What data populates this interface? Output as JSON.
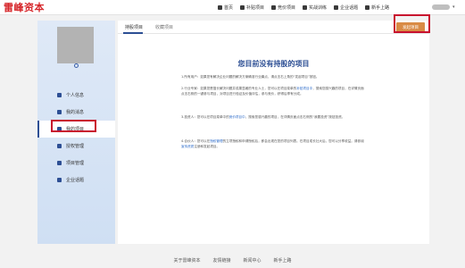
{
  "header": {
    "logo": "雷峰资本",
    "nav": [
      {
        "label": "首页",
        "icon": "home-icon"
      },
      {
        "label": "补贴项目",
        "icon": "grid-icon"
      },
      {
        "label": "竞价项目",
        "icon": "gavel-icon"
      },
      {
        "label": "实战训练",
        "icon": "target-icon"
      },
      {
        "label": "企业话题",
        "icon": "chat-icon"
      },
      {
        "label": "新手上路",
        "icon": "compass-icon"
      }
    ]
  },
  "sidebar": {
    "items": [
      {
        "label": "个人信息",
        "icon": "user-icon"
      },
      {
        "label": "我的消息",
        "icon": "message-icon"
      },
      {
        "label": "我的项目",
        "icon": "project-icon",
        "active": true
      },
      {
        "label": "授权管理",
        "icon": "key-icon"
      },
      {
        "label": "项目管理",
        "icon": "list-icon"
      },
      {
        "label": "企业话题",
        "icon": "topic-icon"
      }
    ]
  },
  "main": {
    "tabs": [
      "持股项目",
      "收藏项目"
    ],
    "launch_button": "发起项目",
    "empty_title": "您目前没有持股的项目",
    "paragraphs": [
      {
        "a": "1.所有用户：如果您有解决企业问题的解决方案确准行业痛点，请点击右上角的“发起项目”按钮。"
      },
      {
        "a": "2.行业专家：如果您是擅长解决问题并成果显著的专业人士，您可以在项目菜单的",
        "link": "补贴项目中",
        "b": "，搜索您感兴趣的项目，在详情页面点击右侧的一键参与项目，对项目进行验证及价值评估，参与竞价，获得后享有分成。"
      },
      {
        "a": "3.投资人：您可以在项目菜单中的",
        "link": "竞价项目中",
        "b": "，搜索您感兴趣的项目，在详情页面点击右侧的“我要投资”按钮投资。"
      },
      {
        "a": "4.合伙人：您可以在",
        "link": "授权管理",
        "b": "的立项授权和申请授权后，即会出现在您的项目列表。在项目成长壮大后，您可以分享收益。请参阅",
        "link2": "宣传资质",
        "c": "注册和发起项目。"
      }
    ]
  },
  "footer": {
    "links": [
      "关于雷峰资本",
      "友情链接",
      "新闻中心",
      "新手上路"
    ]
  },
  "colors": {
    "brand_red": "#d6262a",
    "brand_blue": "#2d4f94",
    "launch_orange": "#d98b45",
    "highlight": "#c8102e"
  }
}
